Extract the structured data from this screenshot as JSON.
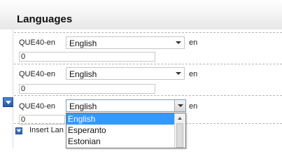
{
  "section": {
    "title": "Languages"
  },
  "rows": [
    {
      "label": "QUE40-en",
      "selected_language": "English",
      "code": "en",
      "value": "0"
    },
    {
      "label": "QUE40-en",
      "selected_language": "English",
      "code": "en",
      "value": "0"
    },
    {
      "label": "QUE40-en",
      "selected_language": "English",
      "code": "en",
      "value": "0"
    }
  ],
  "insert": {
    "label": "Insert Lan"
  },
  "dropdown": {
    "options": [
      "English",
      "Esperanto",
      "Estonian"
    ],
    "selected_index": 0
  },
  "colors": {
    "selection": "#3399ff",
    "menu_button": "#2f66b6"
  }
}
